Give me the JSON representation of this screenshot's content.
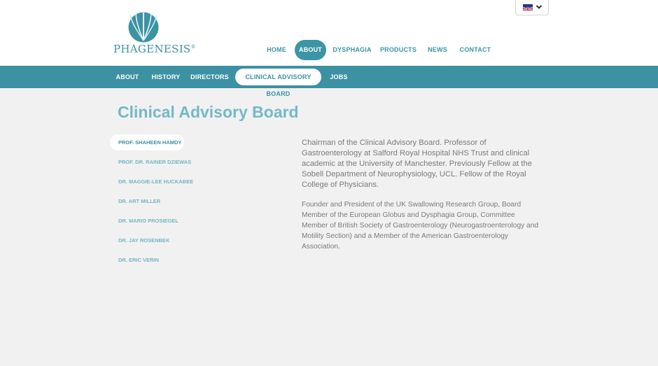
{
  "brand": {
    "name": "PHAGENESIS",
    "mark": "®"
  },
  "language": {
    "selected": "English (UK flag)",
    "icon": "uk-flag-icon"
  },
  "main_nav": [
    "HOME",
    "ABOUT",
    "DYSPHAGIA",
    "PRODUCTS",
    "NEWS",
    "CONTACT"
  ],
  "main_nav_active": "ABOUT",
  "sub_nav": [
    "ABOUT",
    "HISTORY",
    "DIRECTORS",
    "CLINICAL ADVISORY BOARD",
    "JOBS"
  ],
  "sub_nav_active": "CLINICAL ADVISORY BOARD",
  "page": {
    "title": "Clinical Advisory Board"
  },
  "people": [
    "PROF. SHAHEEN HAMDY",
    "PROF. DR. RAINER DZIEWAS",
    "DR. MAGGIE-LEE HUCKABEE",
    "DR. ART MILLER",
    "DR. MARIO PROSIEGEL",
    "DR. JAY ROSENBEK",
    "DR. ERIC VERIN"
  ],
  "people_active": "PROF. SHAHEEN HAMDY",
  "bio": {
    "p1": "Chairman of the Clinical Advisory Board. Professor of Gastroenterology at Salford Royal Hospital NHS Trust and clinical academic at the University of Manchester. Previously Fellow at the Sobell Department of Neurophysiology, UCL. Fellow of the Royal College of Physicians.",
    "p2": "Founder and President of the UK Swallowing Research Group, Board Member of the European Globus and Dysphagia Group, Committee Member of British Society of Gastroenterology (Neurogastroenterology and Motility Section) and a Member of the American Gastroenterology Association."
  },
  "colors": {
    "accent": "#3c91a3",
    "light_accent": "#73b9c6",
    "text_grey": "#7b7b7b",
    "background": "#f1f1f1"
  }
}
